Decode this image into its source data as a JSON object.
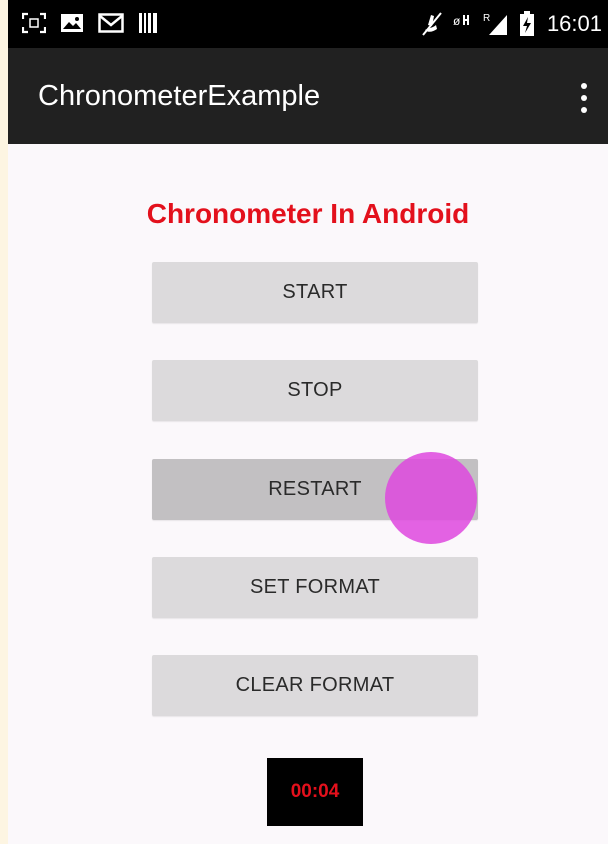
{
  "status_bar": {
    "time": "16:01",
    "left_icons": [
      "screenshot-icon",
      "picture-icon",
      "gmail-icon",
      "barcode-icon"
    ],
    "right_icons": [
      "mute-icon",
      "wifi-icon",
      "signal-icon",
      "battery-icon"
    ]
  },
  "action_bar": {
    "title": "ChronometerExample",
    "overflow_icon": "more-vertical-icon"
  },
  "main": {
    "heading": "Chronometer In Android",
    "buttons": [
      {
        "label": "START"
      },
      {
        "label": "STOP"
      },
      {
        "label": "RESTART"
      },
      {
        "label": "SET FORMAT"
      },
      {
        "label": "CLEAR FORMAT"
      }
    ],
    "chronometer": "00:04"
  },
  "colors": {
    "heading": "#e3101c",
    "chronometer_text": "#e3101c",
    "chronometer_bg": "#000000",
    "action_bar": "#212121",
    "button": "#dcdadc",
    "button_pressed": "#c2c0c2",
    "touch_indicator": "#de48de"
  }
}
